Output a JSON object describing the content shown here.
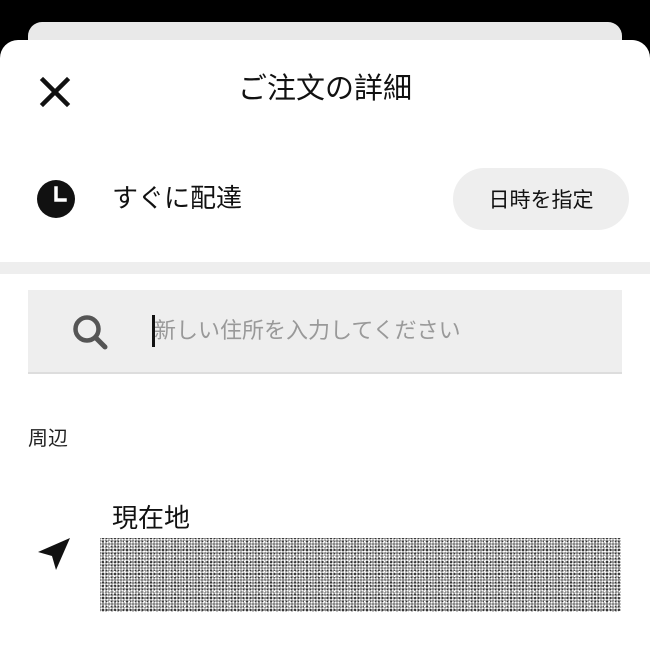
{
  "header": {
    "title": "ご注文の詳細",
    "close_icon": "close-icon"
  },
  "delivery": {
    "icon": "clock-icon",
    "label": "すぐに配達",
    "schedule_button": "日時を指定"
  },
  "search": {
    "icon": "search-icon",
    "value": "",
    "placeholder": "新しい住所を入力してください"
  },
  "nearby": {
    "section_label": "周辺",
    "items": [
      {
        "icon": "location-arrow-icon",
        "title": "現在地"
      }
    ]
  },
  "colors": {
    "background": "#000000",
    "sheet": "#ffffff",
    "control_gray": "#eeeeee",
    "text": "#111111",
    "placeholder": "#999999"
  }
}
